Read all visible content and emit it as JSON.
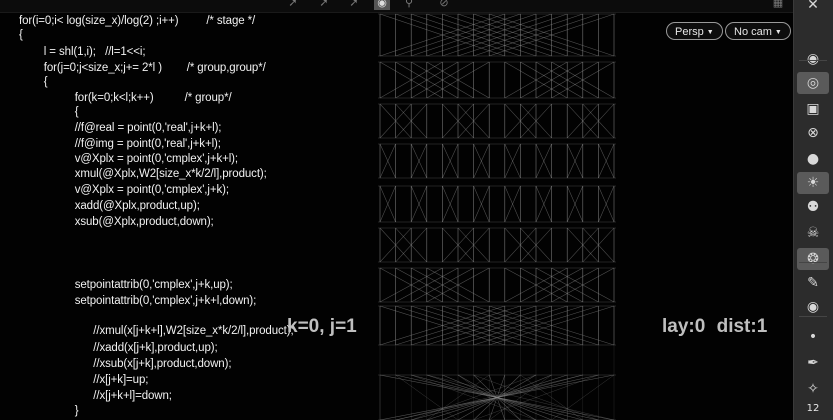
{
  "toolbar": {
    "icons": [
      "select-arrow-icon",
      "transform-arrow-icon",
      "move-arrow-icon",
      "camera-icon",
      "zoom-icon",
      "stop-icon"
    ],
    "right_icons": [
      "layout-icon",
      "close-icon"
    ]
  },
  "viewport": {
    "camera_view_button": "Persp",
    "camera_select_button": "No cam",
    "overlay_left": "k=0, j=1",
    "overlay_right": "lay:0   dist:1"
  },
  "code_lines": [
    "for(i=0;i< log(size_x)/log(2) ;i++)         /* stage */",
    "{",
    "        l = shl(1,i);   //l=1<<i;",
    "        for(j=0;j<size_x;j+= 2*l )        /* group,group*/",
    "        {",
    "                  for(k=0;k<l;k++)          /* group*/",
    "                  {",
    "                  //f@real = point(0,'real',j+k+l);",
    "                  //f@img = point(0,'real',j+k+l);",
    "                  v@Xplx = point(0,'cmplex',j+k+l);",
    "                  xmul(@Xplx,W2[size_x*k/2/l],product);",
    "                  v@Xplx = point(0,'cmplex',j+k);",
    "                  xadd(@Xplx,product,up);",
    "                  xsub(@Xplx,product,down);",
    "                  setpointattrib(0,'cmplex',j+k,up);",
    "                  setpointattrib(0,'cmplex',j+k+l,down);",
    "                        //xmul(x[j+k+l],W2[size_x*k/2/l],product);",
    "                        //xadd(x[j+k],product,up);",
    "                        //xsub(x[j+k],product,down);",
    "                        //x[j+k]=up;",
    "                        //x[j+k+l]=down;",
    "                  }"
  ],
  "shelf": {
    "tools": [
      {
        "icon": "handle-icon",
        "active": false
      },
      {
        "icon": "ghost-icon",
        "active": true
      },
      {
        "icon": "lock-icon",
        "active": false
      },
      {
        "icon": "snap-icon",
        "active": false
      },
      {
        "icon": "sphere-icon",
        "active": false
      },
      {
        "icon": "light-icon",
        "active": true
      },
      {
        "icon": "pin-icon",
        "active": false
      },
      {
        "icon": "skull-icon",
        "active": false
      },
      {
        "icon": "soccer-ball-icon",
        "active": true
      },
      {
        "icon": "paint-icon",
        "active": false
      },
      {
        "icon": "eye-icon",
        "active": false
      },
      {
        "icon": "dot-icon",
        "active": false
      },
      {
        "icon": "brush-icon",
        "active": false
      },
      {
        "icon": "wand-icon",
        "active": false
      }
    ],
    "counter": "12"
  },
  "colors": {
    "code_text": "#f2f2f2",
    "overlay_text": "#bfbfbf",
    "network_lines": "#8a8a8a",
    "shelf_bg": "#2c2c2c"
  }
}
